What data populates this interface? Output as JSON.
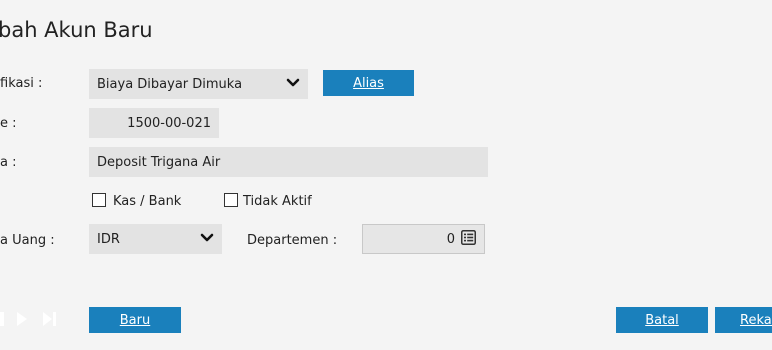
{
  "title": "bah Akun Baru",
  "form": {
    "klasifikasi_label": "fikasi :",
    "klasifikasi_value": "Biaya Dibayar Dimuka",
    "alias_button": "Alias",
    "kode_label": "e :",
    "kode_value": "1500-00-021",
    "nama_label": "a :",
    "nama_value": "Deposit Trigana Air",
    "kas_bank_label": "Kas / Bank",
    "tidak_aktif_label": "Tidak Aktif",
    "mata_uang_label": "a Uang :",
    "mata_uang_value": "IDR",
    "departemen_label": "Departemen :",
    "departemen_value": "0"
  },
  "footer": {
    "baru_button": "Baru",
    "batal_button": "Batal",
    "rekam_button": "Rekam"
  }
}
